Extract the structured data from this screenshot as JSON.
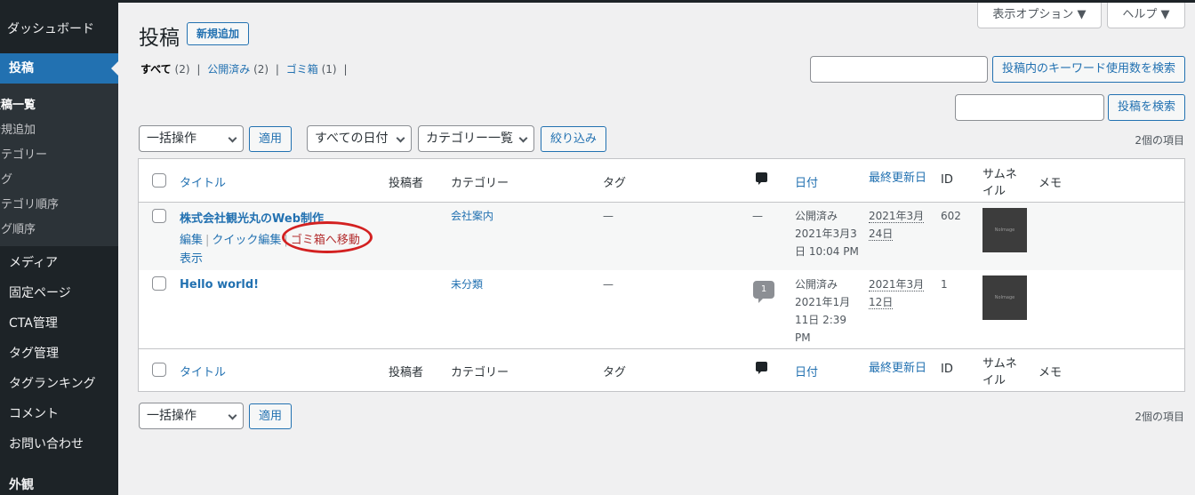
{
  "sidebar": {
    "dashboard": "ダッシュボード",
    "posts": "投稿",
    "sub": [
      {
        "label": "投稿一覧",
        "current": true
      },
      {
        "label": "新規追加"
      },
      {
        "label": "カテゴリー"
      },
      {
        "label": "タグ"
      },
      {
        "label": "カテゴリ順序"
      },
      {
        "label": "タグ順序"
      }
    ],
    "menu": [
      "メディア",
      "固定ページ",
      "CTA管理",
      "タグ管理",
      "タグランキング",
      "コメント",
      "お問い合わせ",
      "外観"
    ]
  },
  "header": {
    "title": "投稿",
    "new_button": "新規追加",
    "screen_options": "表示オプション ▼",
    "help": "ヘルプ ▼"
  },
  "views": {
    "all": "すべて",
    "all_count": "(2)",
    "published": "公開済み",
    "published_count": "(2)",
    "trash": "ゴミ箱",
    "trash_count": "(1)",
    "sep": "|"
  },
  "search": {
    "keyword_button": "投稿内のキーワード使用数を検索",
    "post_button": "投稿を検索"
  },
  "filters": {
    "bulk": "一括操作",
    "apply": "適用",
    "dates": "すべての日付",
    "categories": "カテゴリー一覧",
    "filter": "絞り込み",
    "count": "2個の項目"
  },
  "columns": {
    "title": "タイトル",
    "author": "投稿者",
    "category": "カテゴリー",
    "tags": "タグ",
    "date": "日付",
    "modified": "最終更新日",
    "id": "ID",
    "thumbnail_1": "サムネ",
    "thumbnail_2": "イル",
    "memo": "メモ"
  },
  "rows": [
    {
      "title": "株式会社観光丸のWeb制作",
      "actions": {
        "edit": "編集",
        "quick": "クイック編集",
        "trash": "ゴミ箱へ移動",
        "view": "表示"
      },
      "category": "会社案内",
      "tags": "—",
      "comments": "—",
      "date": [
        "公開済み",
        "2021年3月3",
        "日 10:04 PM"
      ],
      "modified": [
        "2021年3月",
        "24日"
      ],
      "id": "602",
      "thumb": "NoImage"
    },
    {
      "title": "Hello world!",
      "category": "未分類",
      "tags": "—",
      "comments": "1",
      "date": [
        "公開済み",
        "2021年1月",
        "11日 2:39",
        "PM"
      ],
      "modified": [
        "2021年3月",
        "12日"
      ],
      "id": "1",
      "thumb": "NoImage"
    }
  ]
}
